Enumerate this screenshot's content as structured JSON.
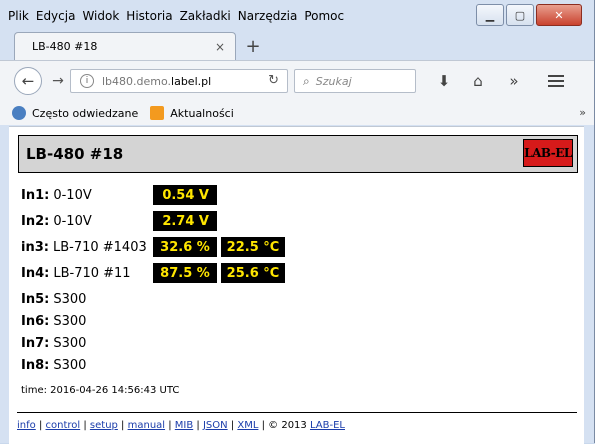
{
  "menu": [
    {
      "label": "Plik"
    },
    {
      "label": "Edycja"
    },
    {
      "label": "Widok"
    },
    {
      "label": "Historia"
    },
    {
      "label": "Zakładki"
    },
    {
      "label": "Narzędzia"
    },
    {
      "label": "Pomoc"
    }
  ],
  "tab": {
    "title": "LB-480 #18",
    "close": "×",
    "new": "+"
  },
  "nav": {
    "url_prefix": "lb480.demo.",
    "url_domain": "label.pl",
    "search_placeholder": "Szukaj"
  },
  "bookmarks": {
    "items": [
      {
        "label": "Często odwiedzane",
        "icon": "globe-icon"
      },
      {
        "label": "Aktualności",
        "icon": "rss-icon"
      }
    ],
    "more": "»"
  },
  "page": {
    "title": "LB-480 #18",
    "logo": "LAB-EL",
    "rows": [
      {
        "label": "In1:",
        "desc": "0-10V",
        "v1": "0.54 V",
        "v2": ""
      },
      {
        "label": "In2:",
        "desc": "0-10V",
        "v1": "2.74 V",
        "v2": ""
      },
      {
        "label": "in3:",
        "desc": "LB-710 #1403",
        "v1": "32.6 %",
        "v2": "22.5 °C"
      },
      {
        "label": "In4:",
        "desc": "LB-710 #11",
        "v1": "87.5 %",
        "v2": "25.6 °C"
      },
      {
        "label": "In5:",
        "desc": "S300",
        "v1": "",
        "v2": ""
      },
      {
        "label": "In6:",
        "desc": "S300",
        "v1": "",
        "v2": ""
      },
      {
        "label": "In7:",
        "desc": "S300",
        "v1": "",
        "v2": ""
      },
      {
        "label": "In8:",
        "desc": "S300",
        "v1": "",
        "v2": ""
      }
    ],
    "time": "time: 2016-04-26 14:56:43 UTC",
    "footer": {
      "links": [
        "info",
        "control",
        "setup",
        "manual",
        "MIB",
        "JSON",
        "XML"
      ],
      "copyright": "© 2013",
      "brand": "LAB-EL"
    }
  },
  "colors": {
    "value_bg": "#000000",
    "value_fg": "#ffe600",
    "logo_bg": "#d61a1a"
  }
}
